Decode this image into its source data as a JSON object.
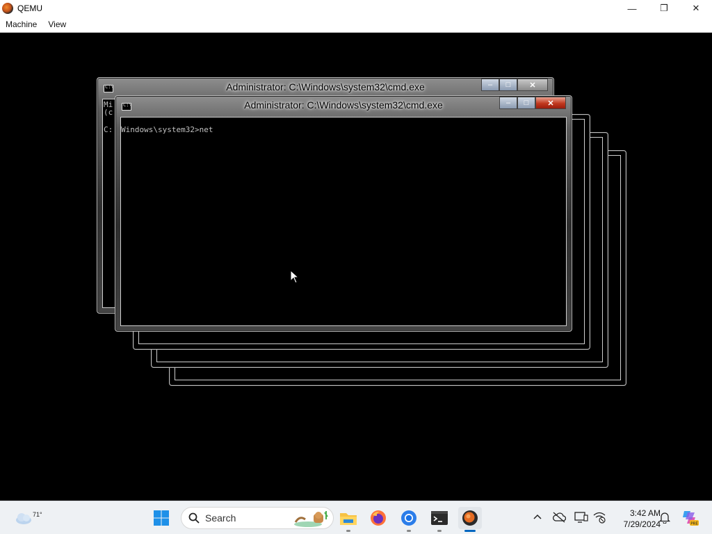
{
  "qemu": {
    "title": "QEMU",
    "menu": [
      "Machine",
      "View"
    ],
    "controls": {
      "minimize": "—",
      "restore": "❐",
      "close": "✕"
    }
  },
  "guest": {
    "cmd_windows": [
      {
        "title": "Administrator: C:\\Windows\\system32\\cmd.exe"
      },
      {
        "title": "Administrator: C:\\Windows\\system32\\cmd.exe"
      }
    ],
    "background_text": {
      "line1": "Mi",
      "line2": "(c",
      "line3": "C:"
    },
    "prompt_line": "Windows\\system32>net"
  },
  "taskbar": {
    "weather_temp": "71°",
    "search_placeholder": "Search",
    "apps": [
      "start-icon",
      "file-explorer-icon",
      "firefox-icon",
      "chrome-icon",
      "terminal-icon",
      "qemu-icon"
    ],
    "tray": [
      "chevron-up-icon",
      "cloud-off-icon",
      "display-icon",
      "wifi-off-icon",
      "notification-bell-icon",
      "copilot-icon"
    ],
    "time": "3:42 AM",
    "date": "7/29/2024",
    "copilot_badge": "PRE"
  }
}
